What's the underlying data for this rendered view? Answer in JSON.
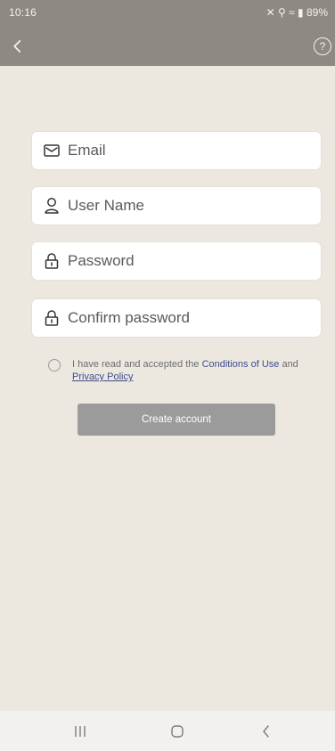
{
  "status_bar": {
    "time": "10:16",
    "icons_text": "✕ ⚲ ≈ ▮ 89%"
  },
  "appbar": {
    "back_icon": "chevron-left-icon",
    "help_icon": "help-icon",
    "help_glyph": "?"
  },
  "form": {
    "email_placeholder": "Email",
    "username_placeholder": "User Name",
    "password_placeholder": "Password",
    "confirm_placeholder": "Confirm password"
  },
  "agreement": {
    "prefix": "I have read and accepted the ",
    "conditions_link": "Conditions of Use",
    "middle": " and ",
    "privacy_link": "Privacy Policy"
  },
  "create_button": {
    "label": "Create account"
  },
  "colors": {
    "header_bg": "#8E8983",
    "page_bg": "#ECE8DF",
    "button_bg": "#9B9B9B",
    "link": "#3E4E8C"
  }
}
